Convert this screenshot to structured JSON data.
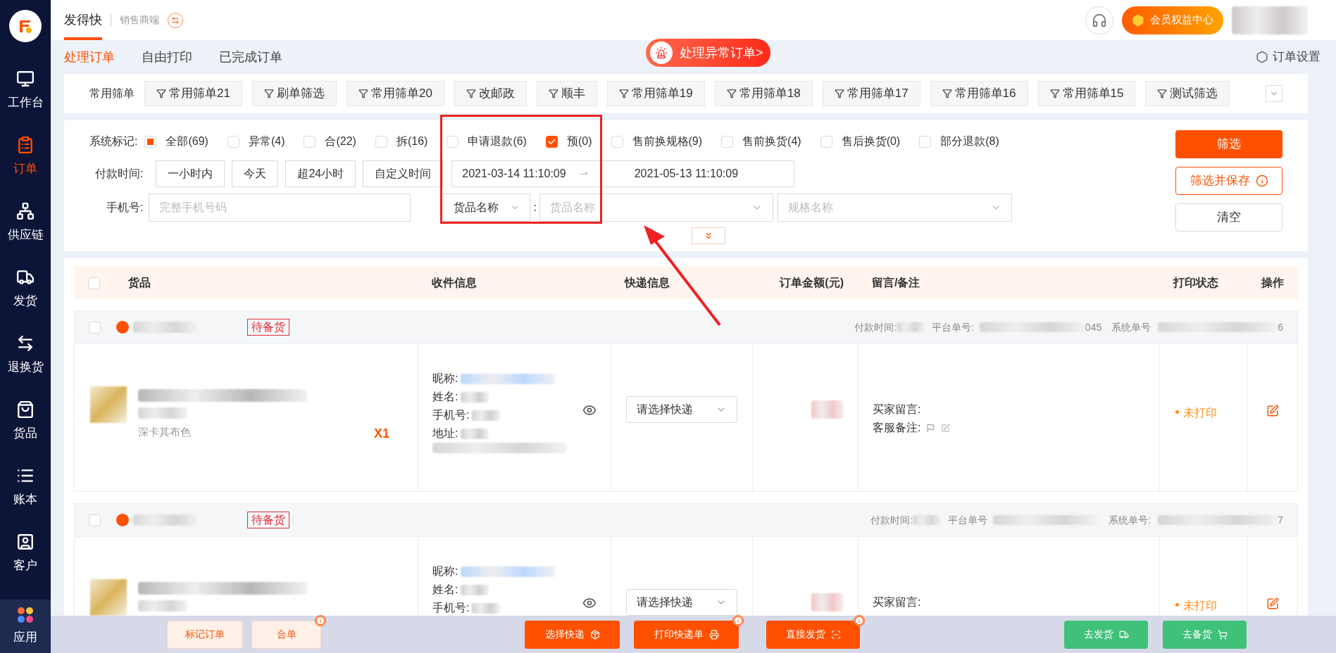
{
  "app": {
    "name": "发得快",
    "role": "销售商端"
  },
  "sidebar": {
    "items": [
      {
        "label": "工作台",
        "selected": false
      },
      {
        "label": "订单",
        "selected": true
      },
      {
        "label": "供应链",
        "selected": false
      },
      {
        "label": "发货",
        "selected": false
      },
      {
        "label": "退换货",
        "selected": false
      },
      {
        "label": "货品",
        "selected": false
      },
      {
        "label": "账本",
        "selected": false
      },
      {
        "label": "客户",
        "selected": false
      }
    ],
    "apps": "应用"
  },
  "header": {
    "member_button": "会员权益中心"
  },
  "tabs": [
    {
      "label": "处理订单",
      "selected": true
    },
    {
      "label": "自由打印",
      "selected": false
    },
    {
      "label": "已完成订单",
      "selected": false
    }
  ],
  "alert_button": "处理异常订单>",
  "settings_link": "订单设置",
  "saved_filters": {
    "label": "常用筛单",
    "items": [
      "常用筛单21",
      "刷单筛选",
      "常用筛单20",
      "改邮政",
      "顺丰",
      "常用筛单19",
      "常用筛单18",
      "常用筛单17",
      "常用筛单16",
      "常用筛单15",
      "测试筛选"
    ]
  },
  "filters": {
    "mark_label": "系统标记:",
    "marks": [
      {
        "label": "全部(69)",
        "kind": "all",
        "checked": true
      },
      {
        "label": "异常(4)",
        "kind": "flag",
        "checked": false
      },
      {
        "label": "合(22)",
        "kind": "flag",
        "checked": false
      },
      {
        "label": "拆(16)",
        "kind": "flag",
        "checked": false
      },
      {
        "label": "申请退款(6)",
        "kind": "flag",
        "checked": false
      },
      {
        "label": "预(0)",
        "kind": "flag",
        "checked": true
      },
      {
        "label": "售前换规格(9)",
        "kind": "flag",
        "checked": false
      },
      {
        "label": "售前换货(4)",
        "kind": "flag",
        "checked": false
      },
      {
        "label": "售后换货(0)",
        "kind": "flag",
        "checked": false
      },
      {
        "label": "部分退款(8)",
        "kind": "flag",
        "checked": false
      }
    ],
    "pay_time_label": "付款时间:",
    "presets": [
      "一小时内",
      "今天",
      "超24小时",
      "自定义时间"
    ],
    "date_start": "2021-03-14 11:10:09",
    "date_separator": "⇀",
    "date_end": "2021-05-13 11:10:09",
    "phone_label": "手机号:",
    "phone_placeholder": "完整手机号码",
    "goods_select": "货品名称",
    "goods_colon": ":",
    "goods_placeholder": "货品名称",
    "spec_placeholder": "规格名称",
    "expanded": false,
    "buttons": [
      {
        "label": "筛选",
        "kind": "primary",
        "info": false
      },
      {
        "label": "筛选并保存",
        "kind": "outline",
        "info": true
      },
      {
        "label": "清空",
        "kind": "plain",
        "info": false
      }
    ]
  },
  "table": {
    "all_checked": false,
    "columns": [
      "货品",
      "收件信息",
      "快递信息",
      "订单金额(元)",
      "留言/备注",
      "打印状态",
      "操作"
    ],
    "orders": [
      {
        "checked": false,
        "status": "待备货",
        "pay_time_label": "付款时间:",
        "platform_label": "平台单号:",
        "platform_tail": "045",
        "system_label": "系统单号",
        "system_tail": "6",
        "spec": "深卡其布色",
        "quantity": "X1",
        "recipient_labels": [
          "昵称:",
          "姓名:",
          "手机号:",
          "地址:"
        ],
        "express_placeholder": "请选择快递",
        "notes": [
          "买家留言:",
          "客服备注:"
        ],
        "print_status": "未打印"
      },
      {
        "checked": false,
        "status": "待备货",
        "pay_time_label": "付款时间:",
        "platform_label": "平台单号",
        "system_label": "系统单号:",
        "system_tail": "7",
        "recipient_labels": [
          "昵称:",
          "姓名:",
          "手机号:"
        ],
        "express_placeholder": "请选择快递",
        "notes": [
          "买家留言:"
        ],
        "print_status": "未打印"
      }
    ]
  },
  "actions": [
    {
      "label": "标记订单",
      "kind": "light",
      "info": false
    },
    {
      "label": "合单",
      "kind": "light",
      "info": true
    },
    {
      "label": "选择快递",
      "kind": "primary",
      "info": false
    },
    {
      "label": "打印快递单",
      "kind": "primary",
      "info": true
    },
    {
      "label": "直接发货",
      "kind": "primary",
      "info": true
    },
    {
      "label": "去发货",
      "kind": "green",
      "info": false
    },
    {
      "label": "去备货",
      "kind": "green",
      "info": false
    }
  ]
}
